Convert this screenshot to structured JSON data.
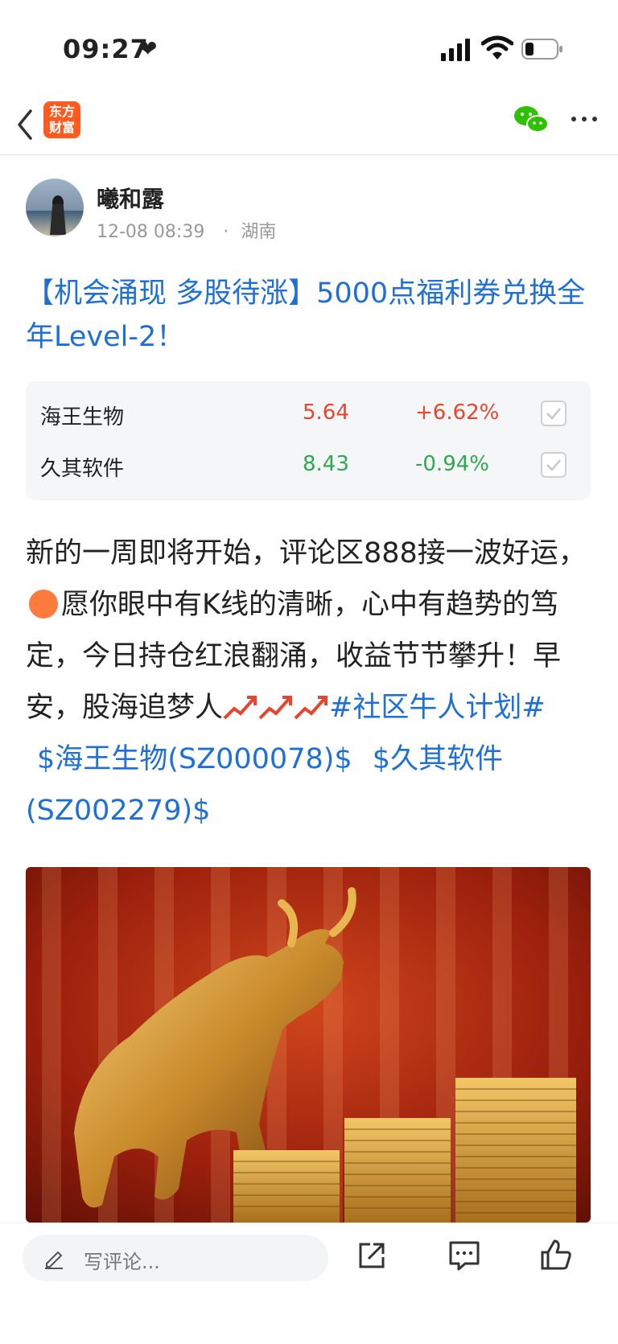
{
  "status_bar": {
    "time": "09:27",
    "heart": "❤"
  },
  "nav": {
    "logo_line1": "东方",
    "logo_line2": "财富"
  },
  "post": {
    "author": "曦和露",
    "time": "12-08 08:39",
    "separator": "·",
    "location": "湖南",
    "title": "【机会涌现 多股待涨】5000点福利券兑换全年Level-2！"
  },
  "stocks": [
    {
      "name": "海王生物",
      "price": "5.64",
      "change": "+6.62%",
      "direction": "up"
    },
    {
      "name": "久其软件",
      "price": "8.43",
      "change": "-0.94%",
      "direction": "down"
    }
  ],
  "body": {
    "text1": "新的一周即将开始，评论区888接一波好运，",
    "text2": "愿你眼中有K线的清晰，心中有趋势的笃定，今日持仓红浪翻涌，收益节节攀升！早安，股海追梦人",
    "topic": "#社区牛人计划#",
    "stock_link1": "$海王生物(SZ000078)$",
    "stock_link2": "$久其软件(SZ002279)$"
  },
  "bottom": {
    "comment_placeholder": "写评论..."
  },
  "colors": {
    "link": "#1e6fd6",
    "up": "#e8452e",
    "down": "#2fa84f",
    "logo": "#ff5a1f"
  }
}
